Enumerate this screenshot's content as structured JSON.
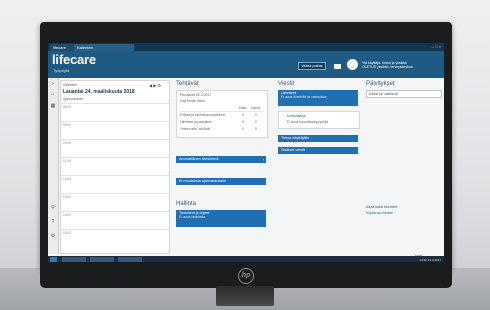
{
  "browser": {
    "tabs": [
      "lifecare",
      "Kalenteri"
    ],
    "window_controls": "– □ ×"
  },
  "header": {
    "logo": "lifecare",
    "logo_sub": "Työpöytä",
    "button_label": "Valitse potilas",
    "user_line1": "Ylä käyttäjä- tiedot ja yksikkö",
    "user_line2": "OLETUS yksikkö, terveyskeskus"
  },
  "calendar": {
    "top_label": "Kalenteri",
    "date": "Lauantai 24. maaliskuuta 2018",
    "subheader": "Ajanvaraukset",
    "times": [
      "08:00",
      "09:00",
      "10:00",
      "11:00",
      "12:00",
      "13:00",
      "14:00",
      "15:00"
    ]
  },
  "tehtavat": {
    "title": "Tehtävät",
    "card_title": "Perusteet 22.3.2017",
    "card_sub": "Käyt tämän viikon",
    "col1": "Käsit.",
    "col2": "Valmiit",
    "rows": [
      {
        "label": "Potilaat ja kotihoitosuunnitelmat",
        "a": "0",
        "b": "0"
      },
      {
        "label": "Lähetteet ja palautteet",
        "a": "0",
        "b": "0"
      },
      {
        "label": "Yhteenvetot, tehtävät",
        "a": "0",
        "b": "0"
      }
    ],
    "btn1": "Ammatillinen tiivistelmä",
    "btn2": "Ei muutoksia ajanvarauksiin"
  },
  "viestit": {
    "title": "Viestit",
    "tiles": [
      {
        "title": "Lähetteet",
        "sub": "Ei uusia lähetteitä tai vastauksia"
      },
      {
        "title": "Konsultaatiot",
        "sub": "Ei uusia konsultaatiopyyntöjä"
      },
      {
        "title": "Tietoa käyttäjälle",
        "sub": ""
      },
      {
        "title": "Sisäiset viestit",
        "sub": ""
      }
    ]
  },
  "paivitykset": {
    "title": "Päivitykset",
    "select_value": "Kaikki tai valittavat"
  },
  "hallinta": {
    "title": "Hallinta",
    "tile_title": "Tiedotteet ja ohjeet",
    "tile_sub": "Ei uusia tiedotteita"
  },
  "links": [
    "Näytä kaikki tiedotteet",
    "Kirjoita uusi tiedote"
  ],
  "status": {
    "zoom": "− ─────── + 100%"
  },
  "taskbar": {
    "clock": "14:32 23.3.2017"
  },
  "colors": {
    "header": "#1f5a85",
    "accent_tile": "#1f6fb2",
    "tabbar": "#12364f"
  }
}
